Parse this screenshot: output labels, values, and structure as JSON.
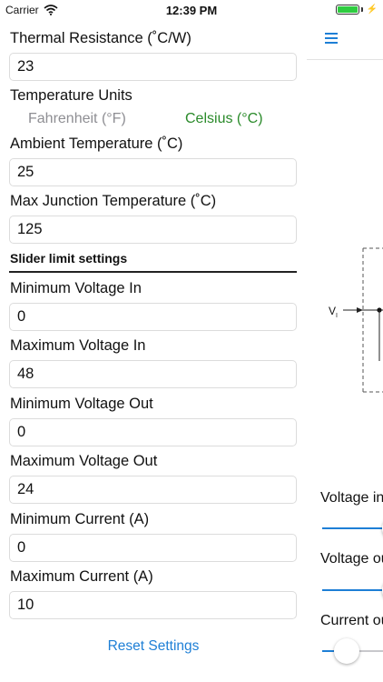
{
  "status_bar": {
    "carrier": "Carrier",
    "time": "12:39 PM",
    "battery_percent": 100
  },
  "settings": {
    "thermal_resistance": {
      "label": "Thermal Resistance (˚C/W)",
      "value": "23"
    },
    "temperature_units": {
      "label": "Temperature Units",
      "options": [
        "Fahrenheit (°F)",
        "Celsius (°C)"
      ],
      "selected": "Celsius (°C)"
    },
    "ambient_temperature": {
      "label": "Ambient Temperature (˚C)",
      "value": "25"
    },
    "max_junction_temperature": {
      "label": "Max Junction Temperature (˚C)",
      "value": "125"
    },
    "slider_limits_header": "Slider limit settings",
    "min_voltage_in": {
      "label": "Minimum Voltage In",
      "value": "0"
    },
    "max_voltage_in": {
      "label": "Maximum Voltage In",
      "value": "48"
    },
    "min_voltage_out": {
      "label": "Minimum Voltage Out",
      "value": "0"
    },
    "max_voltage_out": {
      "label": "Maximum Voltage Out",
      "value": "24"
    },
    "min_current": {
      "label": "Minimum Current (A)",
      "value": "0"
    },
    "max_current": {
      "label": "Maximum Current (A)",
      "value": "10"
    },
    "reset_label": "Reset Settings"
  },
  "main_view": {
    "menu_icon": "hamburger-menu-icon",
    "circuit": {
      "input_label": "V",
      "input_subscript": "I"
    },
    "sliders": [
      {
        "label": "Voltage in",
        "fraction": 1.0
      },
      {
        "label": "Voltage out",
        "fraction": 1.0
      },
      {
        "label": "Current out",
        "fraction": 0.2
      }
    ]
  },
  "colors": {
    "accent_blue": "#1e7fd6",
    "selected_green": "#2a8a2a",
    "inactive_gray": "#8e8e93"
  }
}
